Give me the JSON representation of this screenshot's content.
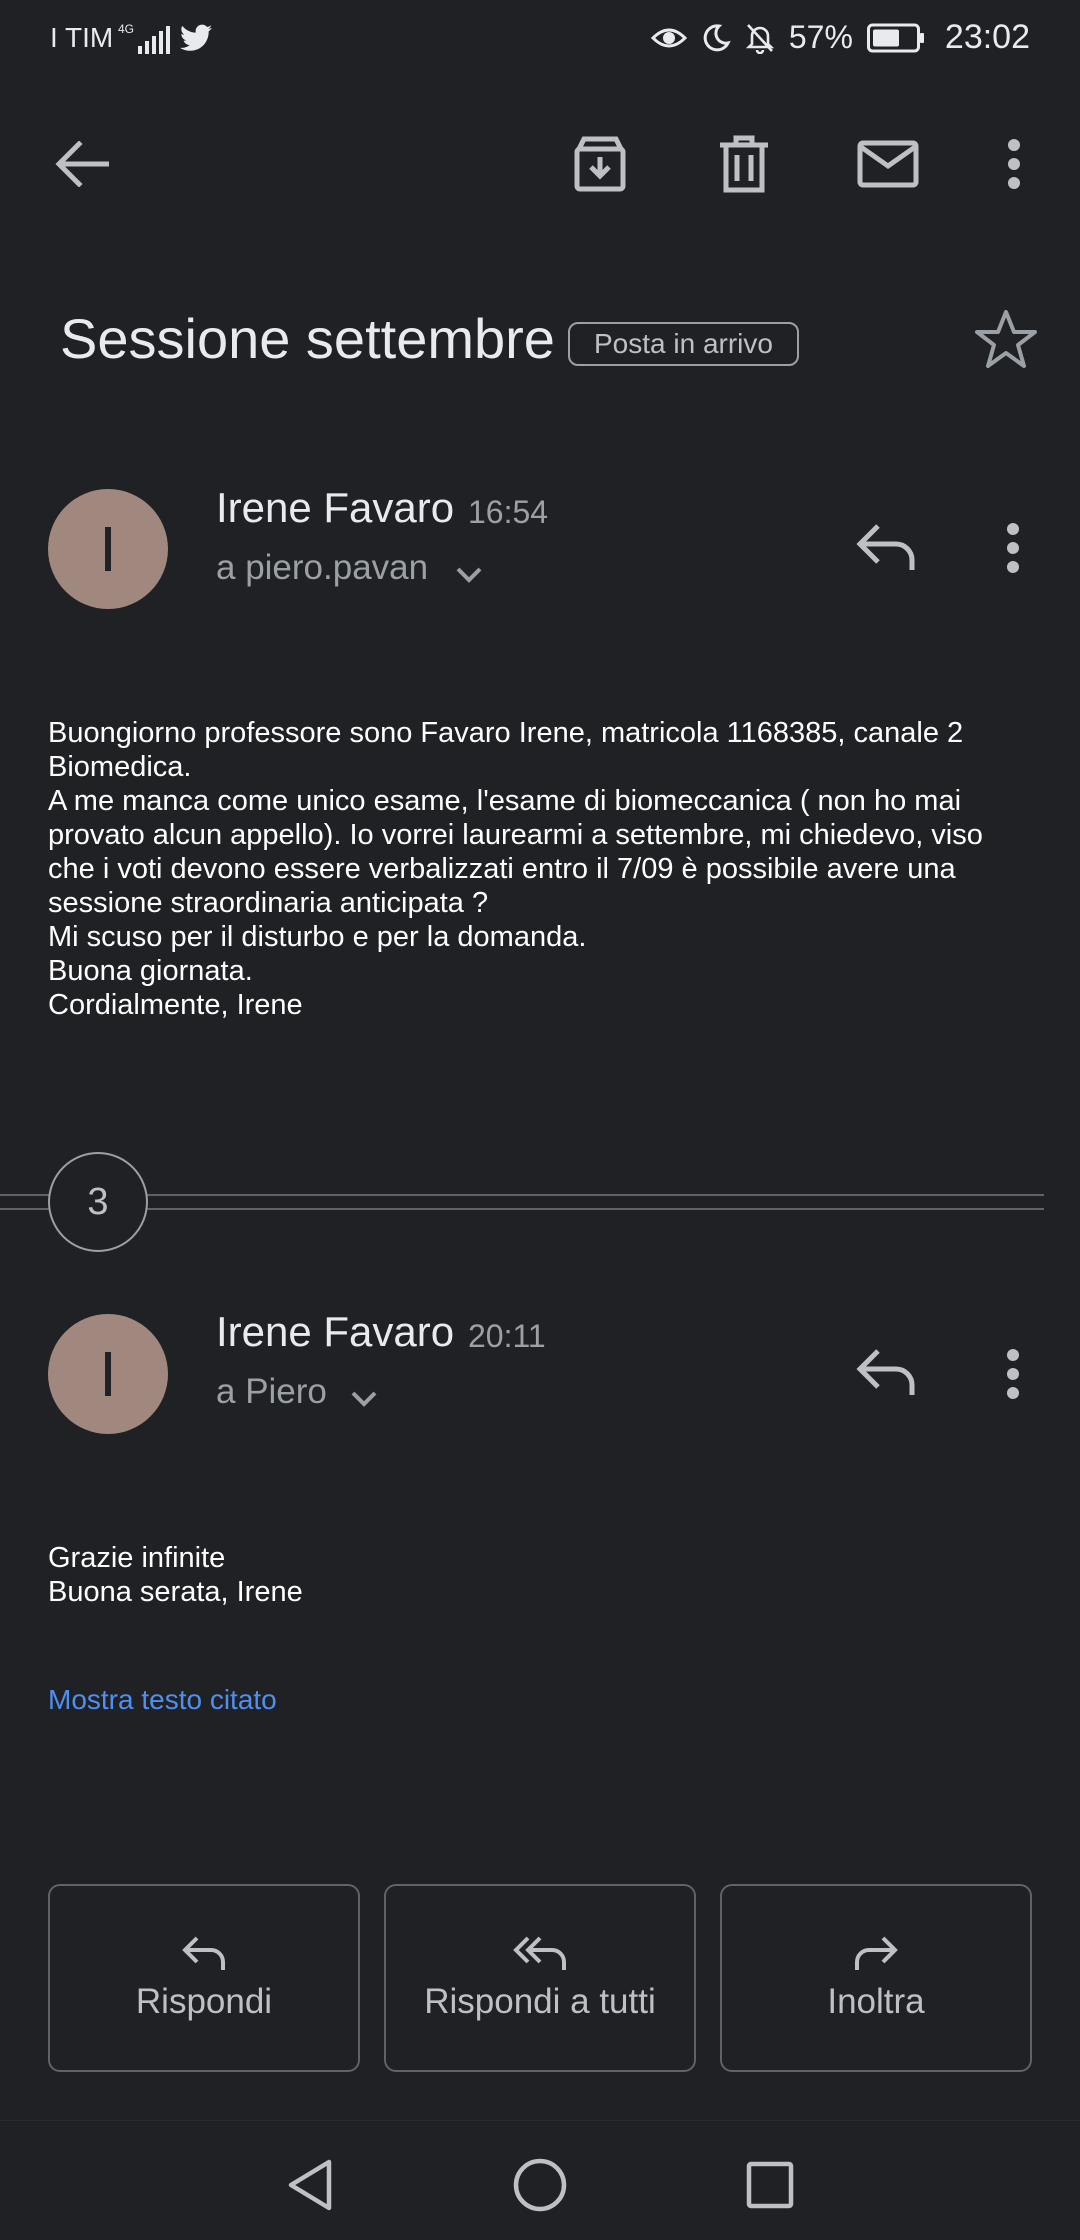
{
  "status_bar": {
    "carrier": "I TIM",
    "network_badge": "4G",
    "battery_percent": "57%",
    "time": "23:02",
    "icons": [
      "signal-icon",
      "twitter-icon",
      "eye-icon",
      "moon-icon",
      "bell-off-icon",
      "battery-icon"
    ]
  },
  "toolbar": {
    "icons": [
      "back-arrow-icon",
      "archive-icon",
      "trash-icon",
      "mail-icon",
      "more-vert-icon"
    ]
  },
  "thread": {
    "subject": "Sessione settembre",
    "label": "Posta in arrivo",
    "collapsed_count": "3"
  },
  "messages": [
    {
      "avatar_letter": "I",
      "sender": "Irene Favaro",
      "time": "16:54",
      "recipient": "a piero.pavan",
      "body": [
        "Buongiorno professore sono Favaro Irene, matricola 1168385, canale 2",
        "Biomedica.",
        "A me manca come unico esame, l'esame di biomeccanica ( non ho mai",
        "provato alcun appello). Io vorrei laurearmi a settembre, mi chiedevo, viso",
        "che i voti devono essere verbalizzati entro il 7/09 è possibile avere una",
        "sessione straordinaria anticipata ?",
        "Mi scuso per il disturbo e per la domanda.",
        "Buona giornata.",
        "Cordialmente, Irene"
      ]
    },
    {
      "avatar_letter": "I",
      "sender": "Irene Favaro",
      "time": "20:11",
      "recipient": "a Piero",
      "body": [
        "Grazie infinite",
        "Buona serata, Irene"
      ],
      "quoted_link": "Mostra testo citato"
    }
  ],
  "actions": {
    "reply": "Rispondi",
    "reply_all": "Rispondi a tutti",
    "forward": "Inoltra"
  },
  "colors": {
    "background": "#202124",
    "avatar": "#a1887f",
    "link": "#4f8ff0"
  }
}
